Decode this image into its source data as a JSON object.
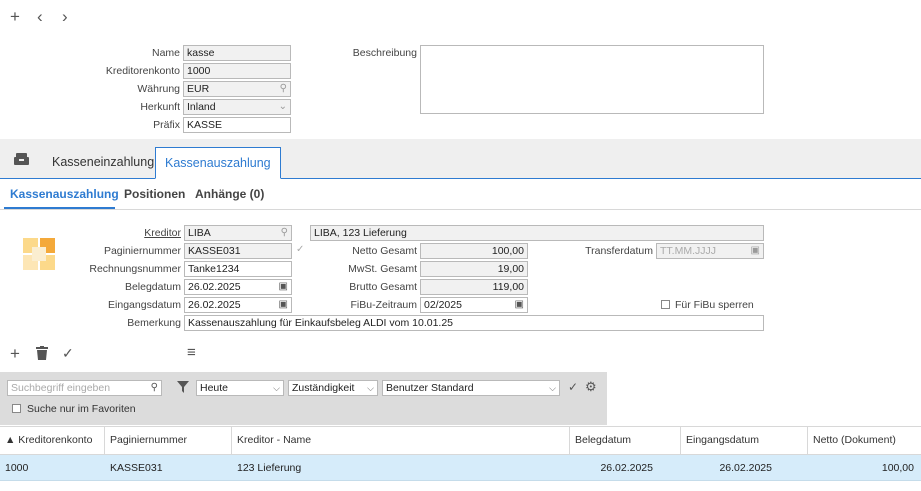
{
  "toolbar_top": {
    "add": "+",
    "back": "‹",
    "forward": "›"
  },
  "header": {
    "name_label": "Name",
    "name_value": "kasse",
    "kreditorenkonto_label": "Kreditorenkonto",
    "kreditorenkonto_value": "1000",
    "waehrung_label": "Währung",
    "waehrung_value": "EUR",
    "herkunft_label": "Herkunft",
    "herkunft_value": "Inland",
    "praefix_label": "Präfix",
    "praefix_value": "KASSE",
    "beschreibung_label": "Beschreibung",
    "beschreibung_value": ""
  },
  "main_tabs": {
    "tab1": "Kasseneinzahlung",
    "tab2": "Kassenauszahlung"
  },
  "sub_tabs": {
    "tab1": "Kassenauszahlung",
    "tab2": "Positionen",
    "tab3": "Anhänge (0)"
  },
  "form": {
    "kreditor_label": "Kreditor",
    "kreditor_value": "LIBA",
    "kreditor_desc": "LIBA, 123 Lieferung",
    "paginiernummer_label": "Paginiernummer",
    "paginiernummer_value": "KASSE031",
    "rechnungsnummer_label": "Rechnungsnummer",
    "rechnungsnummer_value": "Tanke1234",
    "belegdatum_label": "Belegdatum",
    "belegdatum_value": "26.02.2025",
    "eingangsdatum_label": "Eingangsdatum",
    "eingangsdatum_value": "26.02.2025",
    "bemerkung_label": "Bemerkung",
    "bemerkung_value": "Kassenauszahlung für Einkaufsbeleg ALDI vom 10.01.25",
    "netto_label": "Netto Gesamt",
    "netto_value": "100,00",
    "mwst_label": "MwSt. Gesamt",
    "mwst_value": "19,00",
    "brutto_label": "Brutto Gesamt",
    "brutto_value": "119,00",
    "fibu_label": "FiBu-Zeitraum",
    "fibu_value": "02/2025",
    "transfer_label": "Transferdatum",
    "transfer_placeholder": "TT.MM.JJJJ",
    "sperren_label": "Für FiBu sperren"
  },
  "list_toolbar": {
    "add": "+",
    "delete": "🗑",
    "confirm": "✓",
    "menu": "≡"
  },
  "filter": {
    "search_placeholder": "Suchbegriff eingeben",
    "favorites_label": "Suche nur im Favoriten",
    "date_filter": "Heute",
    "responsibility": "Zuständigkeit",
    "user_setting": "Benutzer Standard"
  },
  "grid": {
    "columns": [
      "▲ Kreditorenkonto",
      "Paginiernummer",
      "Kreditor - Name",
      "Belegdatum",
      "Eingangsdatum",
      "Netto (Dokument)"
    ],
    "rows": [
      [
        "1000",
        "KASSE031",
        "123 Lieferung",
        "26.02.2025",
        "26.02.2025",
        "100,00"
      ]
    ]
  },
  "colors": {
    "accent": "#2e7bd1",
    "selected_row": "#d6ecfa",
    "filter_bg": "#dcdcdc",
    "logo_orange": "#f4a93a",
    "logo_yellow": "#fcd98a"
  }
}
